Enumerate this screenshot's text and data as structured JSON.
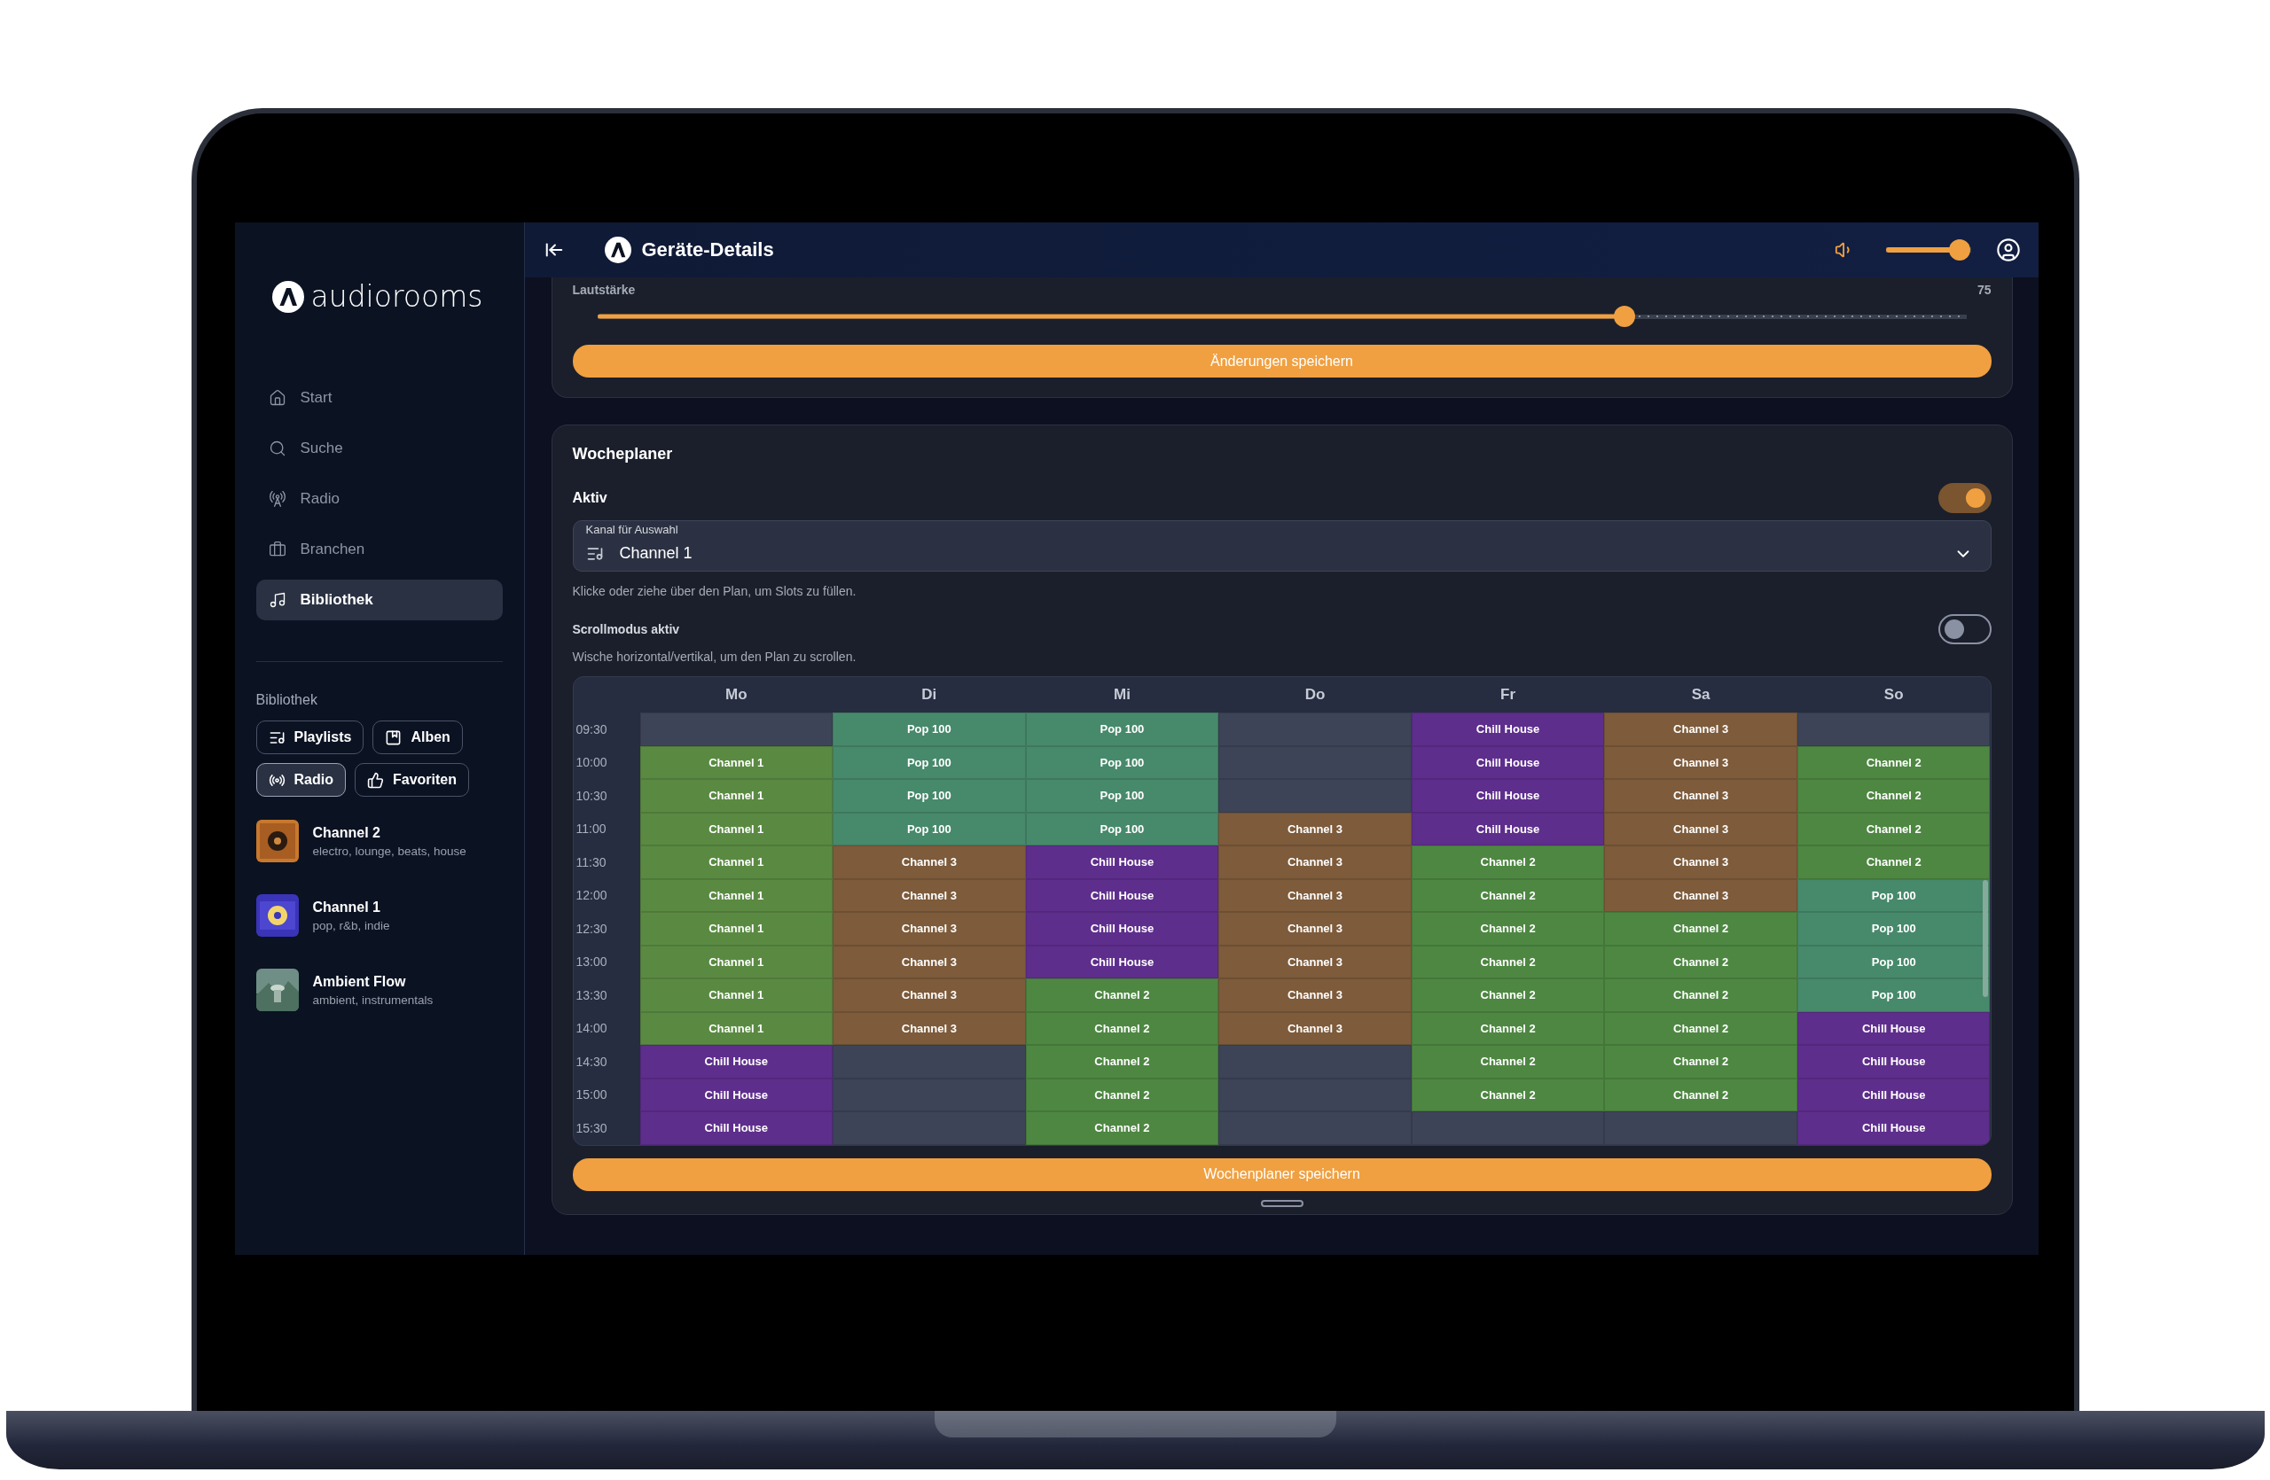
{
  "sidebar": {
    "brand": "audiorooms",
    "nav": [
      {
        "label": "Start",
        "selected": false
      },
      {
        "label": "Suche",
        "selected": false
      },
      {
        "label": "Radio",
        "selected": false
      },
      {
        "label": "Branchen",
        "selected": false
      },
      {
        "label": "Bibliothek",
        "selected": true
      }
    ],
    "section_title": "Bibliothek",
    "filters": [
      {
        "label": "Playlists",
        "selected": false
      },
      {
        "label": "Alben",
        "selected": false
      },
      {
        "label": "Radio",
        "selected": true
      },
      {
        "label": "Favoriten",
        "selected": false
      }
    ],
    "library": [
      {
        "title": "Channel 2",
        "subtitle": "electro, lounge, beats, house"
      },
      {
        "title": "Channel 1",
        "subtitle": "pop, r&b, indie"
      },
      {
        "title": "Ambient Flow",
        "subtitle": "ambient, instrumentals"
      }
    ]
  },
  "header": {
    "title": "Geräte-Details",
    "volume": {
      "level": 0.87
    }
  },
  "volume_panel": {
    "label": "Lautstärke",
    "reading": "75",
    "level": 0.75,
    "button": "Änderungen speichern"
  },
  "planner": {
    "title": "Wocheplaner",
    "active": {
      "label": "Aktiv",
      "on": true
    },
    "channel_select": {
      "label": "Kanal für Auswahl",
      "value": "Channel 1"
    },
    "hint": "Klicke oder ziehe über den Plan, um Slots zu füllen.",
    "scroll_mode": {
      "label": "Scrollmodus aktiv",
      "on": false
    },
    "scroll_hint": "Wische horizontal/vertikal, um den Plan zu scrollen.",
    "days": [
      "Mo",
      "Di",
      "Mi",
      "Do",
      "Fr",
      "Sa",
      "So"
    ],
    "rows": [
      {
        "time": "09:30",
        "cells": [
          {
            "color": "#3d4457"
          },
          {
            "label": "Pop 100",
            "color": "#47896b"
          },
          {
            "label": "Pop 100",
            "color": "#47896b"
          },
          {
            "color": "#3d4457"
          },
          {
            "label": "Chill House",
            "color": "#5e2e8c"
          },
          {
            "label": "Channel 3",
            "color": "#7d5b3b"
          },
          {
            "color": "#3d4457"
          }
        ]
      },
      {
        "time": "10:00",
        "cells": [
          {
            "label": "Channel 1",
            "color": "#5a8a42"
          },
          {
            "label": "Pop 100",
            "color": "#47896b"
          },
          {
            "label": "Pop 100",
            "color": "#47896b"
          },
          {
            "color": "#3d4457"
          },
          {
            "label": "Chill House",
            "color": "#5e2e8c"
          },
          {
            "label": "Channel 3",
            "color": "#7d5b3b"
          },
          {
            "label": "Channel 2",
            "color": "#4e8742"
          }
        ]
      },
      {
        "time": "10:30",
        "cells": [
          {
            "label": "Channel 1",
            "color": "#5a8a42"
          },
          {
            "label": "Pop 100",
            "color": "#47896b"
          },
          {
            "label": "Pop 100",
            "color": "#47896b"
          },
          {
            "color": "#3d4457"
          },
          {
            "label": "Chill House",
            "color": "#5e2e8c"
          },
          {
            "label": "Channel 3",
            "color": "#7d5b3b"
          },
          {
            "label": "Channel 2",
            "color": "#4e8742"
          }
        ]
      },
      {
        "time": "11:00",
        "cells": [
          {
            "label": "Channel 1",
            "color": "#5a8a42"
          },
          {
            "label": "Pop 100",
            "color": "#47896b"
          },
          {
            "label": "Pop 100",
            "color": "#47896b"
          },
          {
            "label": "Channel 3",
            "color": "#7d5b3b"
          },
          {
            "label": "Chill House",
            "color": "#5e2e8c"
          },
          {
            "label": "Channel 3",
            "color": "#7d5b3b"
          },
          {
            "label": "Channel 2",
            "color": "#4e8742"
          }
        ]
      },
      {
        "time": "11:30",
        "cells": [
          {
            "label": "Channel 1",
            "color": "#5a8a42"
          },
          {
            "label": "Channel 3",
            "color": "#7d5b3b"
          },
          {
            "label": "Chill House",
            "color": "#5e2e8c"
          },
          {
            "label": "Channel 3",
            "color": "#7d5b3b"
          },
          {
            "label": "Channel 2",
            "color": "#4e8742"
          },
          {
            "label": "Channel 3",
            "color": "#7d5b3b"
          },
          {
            "label": "Channel 2",
            "color": "#4e8742"
          }
        ]
      },
      {
        "time": "12:00",
        "cells": [
          {
            "label": "Channel 1",
            "color": "#5a8a42"
          },
          {
            "label": "Channel 3",
            "color": "#7d5b3b"
          },
          {
            "label": "Chill House",
            "color": "#5e2e8c"
          },
          {
            "label": "Channel 3",
            "color": "#7d5b3b"
          },
          {
            "label": "Channel 2",
            "color": "#4e8742"
          },
          {
            "label": "Channel 3",
            "color": "#7d5b3b"
          },
          {
            "label": "Pop 100",
            "color": "#47896b"
          }
        ]
      },
      {
        "time": "12:30",
        "cells": [
          {
            "label": "Channel 1",
            "color": "#5a8a42"
          },
          {
            "label": "Channel 3",
            "color": "#7d5b3b"
          },
          {
            "label": "Chill House",
            "color": "#5e2e8c"
          },
          {
            "label": "Channel 3",
            "color": "#7d5b3b"
          },
          {
            "label": "Channel 2",
            "color": "#4e8742"
          },
          {
            "label": "Channel 2",
            "color": "#4e8742"
          },
          {
            "label": "Pop 100",
            "color": "#47896b"
          }
        ]
      },
      {
        "time": "13:00",
        "cells": [
          {
            "label": "Channel 1",
            "color": "#5a8a42"
          },
          {
            "label": "Channel 3",
            "color": "#7d5b3b"
          },
          {
            "label": "Chill House",
            "color": "#5e2e8c"
          },
          {
            "label": "Channel 3",
            "color": "#7d5b3b"
          },
          {
            "label": "Channel 2",
            "color": "#4e8742"
          },
          {
            "label": "Channel 2",
            "color": "#4e8742"
          },
          {
            "label": "Pop 100",
            "color": "#47896b"
          }
        ]
      },
      {
        "time": "13:30",
        "cells": [
          {
            "label": "Channel 1",
            "color": "#5a8a42"
          },
          {
            "label": "Channel 3",
            "color": "#7d5b3b"
          },
          {
            "label": "Channel 2",
            "color": "#4e8742"
          },
          {
            "label": "Channel 3",
            "color": "#7d5b3b"
          },
          {
            "label": "Channel 2",
            "color": "#4e8742"
          },
          {
            "label": "Channel 2",
            "color": "#4e8742"
          },
          {
            "label": "Pop 100",
            "color": "#47896b"
          }
        ]
      },
      {
        "time": "14:00",
        "cells": [
          {
            "label": "Channel 1",
            "color": "#5a8a42"
          },
          {
            "label": "Channel 3",
            "color": "#7d5b3b"
          },
          {
            "label": "Channel 2",
            "color": "#4e8742"
          },
          {
            "label": "Channel 3",
            "color": "#7d5b3b"
          },
          {
            "label": "Channel 2",
            "color": "#4e8742"
          },
          {
            "label": "Channel 2",
            "color": "#4e8742"
          },
          {
            "label": "Chill House",
            "color": "#5e2e8c"
          }
        ]
      },
      {
        "time": "14:30",
        "cells": [
          {
            "label": "Chill House",
            "color": "#5e2e8c"
          },
          {
            "color": "#3d4457"
          },
          {
            "label": "Channel 2",
            "color": "#4e8742"
          },
          {
            "color": "#3d4457"
          },
          {
            "label": "Channel 2",
            "color": "#4e8742"
          },
          {
            "label": "Channel 2",
            "color": "#4e8742"
          },
          {
            "label": "Chill House",
            "color": "#5e2e8c"
          }
        ]
      },
      {
        "time": "15:00",
        "cells": [
          {
            "label": "Chill House",
            "color": "#5e2e8c"
          },
          {
            "color": "#3d4457"
          },
          {
            "label": "Channel 2",
            "color": "#4e8742"
          },
          {
            "color": "#3d4457"
          },
          {
            "label": "Channel 2",
            "color": "#4e8742"
          },
          {
            "label": "Channel 2",
            "color": "#4e8742"
          },
          {
            "label": "Chill House",
            "color": "#5e2e8c"
          }
        ]
      },
      {
        "time": "15:30",
        "cells": [
          {
            "label": "Chill House",
            "color": "#5e2e8c"
          },
          {
            "color": "#3d4457"
          },
          {
            "label": "Channel 2",
            "color": "#4e8742"
          },
          {
            "color": "#3d4457"
          },
          {
            "color": "#3d4457"
          },
          {
            "color": "#3d4457"
          },
          {
            "label": "Chill House",
            "color": "#5e2e8c"
          }
        ]
      }
    ],
    "button": "Wochenplaner speichern"
  }
}
